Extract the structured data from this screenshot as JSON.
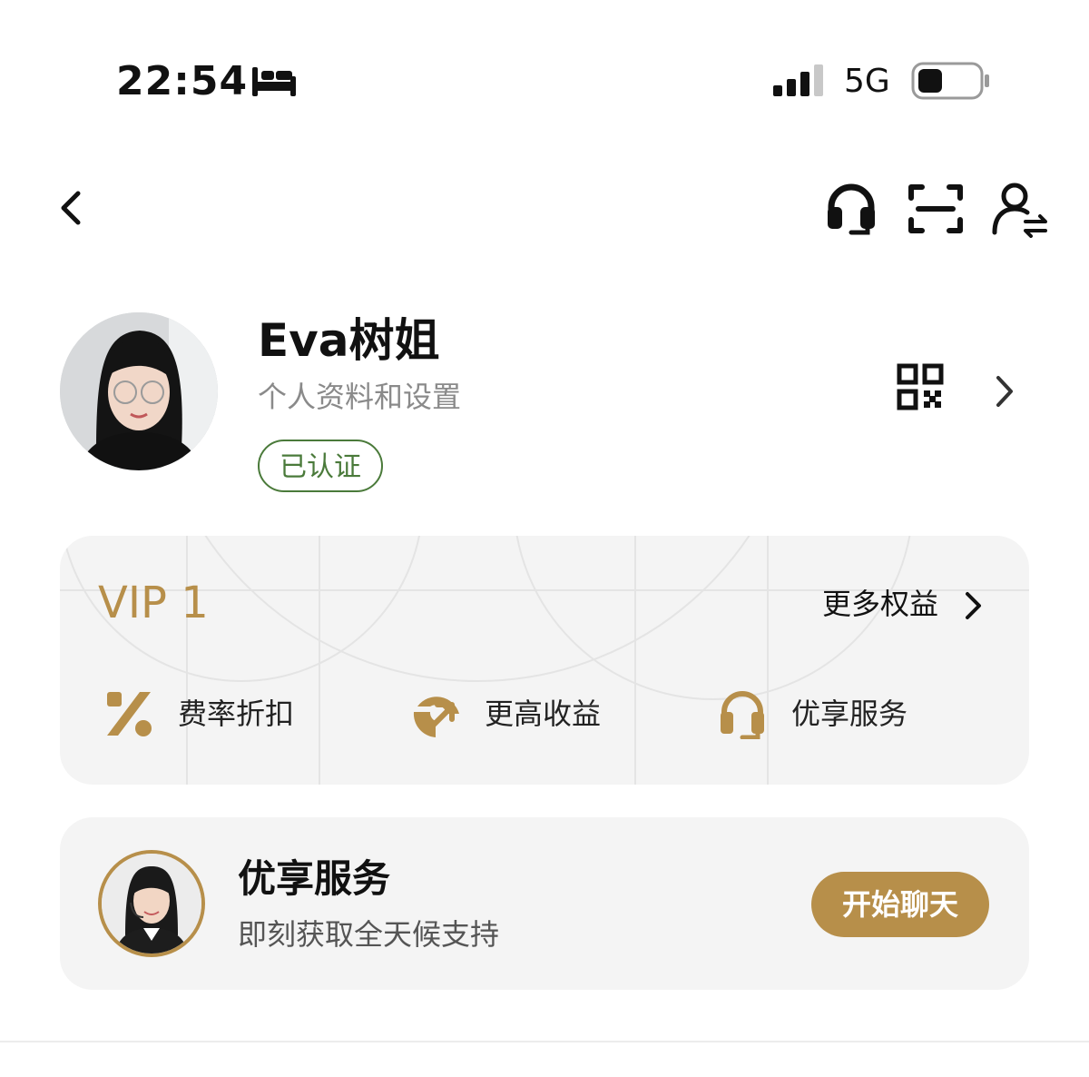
{
  "status_bar": {
    "time": "22:54",
    "focus_icon": "bed-icon",
    "network": "5G",
    "signal_bars": 3,
    "battery_level": 0.3
  },
  "nav": {
    "back_icon": "chevron-left-icon",
    "actions": [
      "headset-icon",
      "scan-icon",
      "switch-user-icon"
    ]
  },
  "profile": {
    "name": "Eva树姐",
    "subtitle": "个人资料和设置",
    "badge": "已认证",
    "qr_icon": "qr-code-icon"
  },
  "vip": {
    "level": "VIP 1",
    "more_label": "更多权益",
    "perks": [
      {
        "label": "费率折扣",
        "icon": "percent-icon"
      },
      {
        "label": "更高收益",
        "icon": "yield-arrow-icon"
      },
      {
        "label": "优享服务",
        "icon": "headset-icon"
      }
    ]
  },
  "service": {
    "title": "优享服务",
    "subtitle": "即刻获取全天候支持",
    "button": "开始聊天"
  },
  "colors": {
    "gold": "#b78f4a",
    "verified_green": "#4a7a3a",
    "card_bg": "#f4f4f4"
  }
}
